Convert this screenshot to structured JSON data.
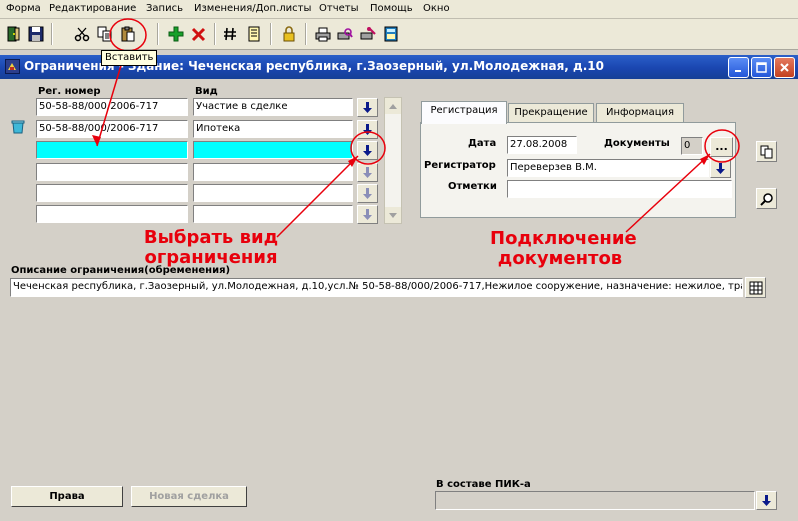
{
  "menu": {
    "items": [
      "Форма",
      "Редактирование",
      "Запись",
      "Изменения/Доп.листы",
      "Отчеты",
      "Помощь",
      "Окно"
    ]
  },
  "toolbar": {
    "tooltip": "Вставить",
    "icons": [
      "exit-icon",
      "save-icon",
      "cut-icon",
      "copy-icon",
      "paste-icon",
      "add-record-icon",
      "delete-record-icon",
      "number-icon",
      "document-icon",
      "lock-icon",
      "printer-icon",
      "print-preview-icon",
      "print-setup-icon",
      "calculator-icon"
    ]
  },
  "window": {
    "title": "Ограничения - Здание: Чеченская республика, г.Заозерный, ул.Молодежная, д.10"
  },
  "grid": {
    "col_reg": "Рег. номер",
    "col_type": "Вид",
    "rows": [
      {
        "reg": "50-58-88/000/2006-717",
        "type": "Участие в сделке"
      },
      {
        "reg": "50-58-88/000/2006-717",
        "type": "Ипотека"
      },
      {
        "reg": "",
        "type": ""
      },
      {
        "reg": "",
        "type": ""
      },
      {
        "reg": "",
        "type": ""
      },
      {
        "reg": "",
        "type": ""
      }
    ]
  },
  "tabs": {
    "registration": "Регистрация",
    "termination": "Прекращение",
    "information": "Информация"
  },
  "registration": {
    "date_label": "Дата",
    "date_value": "27.08.2008",
    "docs_label": "Документы",
    "docs_count": "0",
    "docs_button": "...",
    "registrar_label": "Регистратор",
    "registrar_value": "Переверзев В.М.",
    "notes_label": "Отметки",
    "notes_value": ""
  },
  "annotations": {
    "choose_type_line1": "Выбрать вид",
    "choose_type_line2": "ограничения",
    "docs_line1": "Подключение",
    "docs_line2": "документов",
    "color": "#e8000c"
  },
  "description": {
    "label": "Описание ограничения(обременения)",
    "value": "Чеченская республика, г.Заозерный, ул.Молодежная, д.10,усл.№ 50-58-88/000/2006-717,Нежилое сооружение, назначение: нежилое, транспор"
  },
  "bottom": {
    "rights_button": "Права",
    "new_deal_button": "Новая сделка",
    "pik_label": "В составе ПИК-а",
    "pik_value": ""
  },
  "colors": {
    "titlebar": "#1a46b0",
    "active_row": "#00ffff",
    "form_bg": "#d4d0c8"
  }
}
